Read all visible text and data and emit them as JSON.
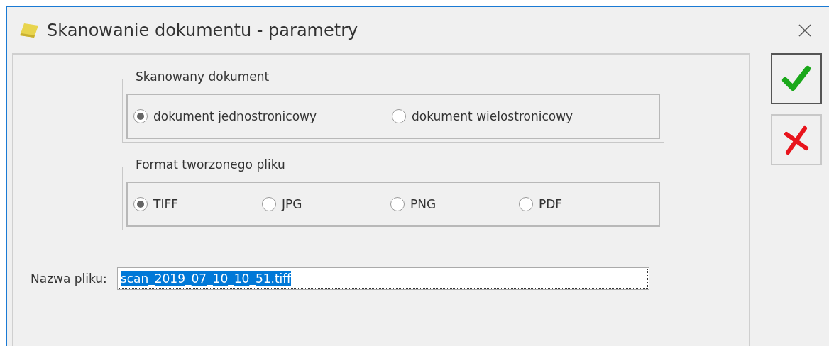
{
  "window": {
    "title": "Skanowanie dokumentu - parametry"
  },
  "groups": [
    {
      "title": "Skanowany dokument",
      "options": [
        {
          "label": "dokument jednostronicowy",
          "selected": true
        },
        {
          "label": "dokument wielostronicowy",
          "selected": false
        }
      ]
    },
    {
      "title": "Format tworzonego pliku",
      "options": [
        {
          "label": "TIFF",
          "selected": true
        },
        {
          "label": "JPG",
          "selected": false
        },
        {
          "label": "PNG",
          "selected": false
        },
        {
          "label": "PDF",
          "selected": false
        }
      ]
    }
  ],
  "filename": {
    "label": "Nazwa pliku:",
    "value": "scan_2019_07_10_10_51.tiff",
    "text_selected": true
  },
  "buttons": [
    {
      "kind": "ok",
      "focused": true
    },
    {
      "kind": "cancel",
      "focused": false
    }
  ]
}
